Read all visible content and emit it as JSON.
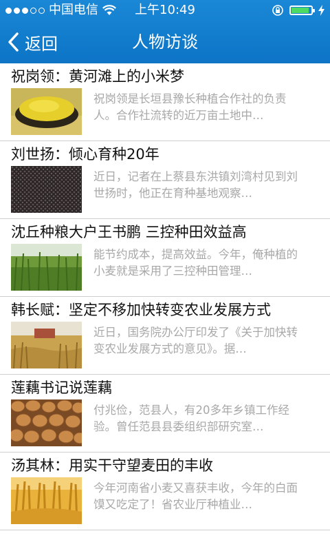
{
  "status_bar": {
    "carrier": "中国电信",
    "time": "上午10:49",
    "signal_bars_filled": 3,
    "signal_bars_total": 5,
    "battery_level": 0.9
  },
  "nav": {
    "back_label": "返回",
    "title": "人物访谈"
  },
  "colors": {
    "nav_background": "#1a88d6",
    "title_text": "#111111",
    "summary_text": "#a8a8a8",
    "divider": "#cfcfcf"
  },
  "articles": [
    {
      "title": "祝岗领：黄河滩上的小米梦",
      "summary": "祝岗领是长垣县豫长种植合作社的负责人。合作社流转的近万亩土地中…",
      "thumbnail": "millet-bowl-image"
    },
    {
      "title": "刘世扬：倾心育种20年",
      "summary": "近日，记者在上蔡县东洪镇刘湾村见到刘世扬时，他正在育种基地观察…",
      "thumbnail": "seeds-image"
    },
    {
      "title": "沈丘种粮大户王书鹏 三控种田效益高",
      "summary": "能节约成本，提高效益。今年，俺种植的小麦就是采用了三控种田管理…",
      "thumbnail": "green-wheat-field-image"
    },
    {
      "title": "韩长赋：坚定不移加快转变农业发展方式",
      "summary": "近日，国务院办公厅印发了《关于加快转变农业发展方式的意见》。据…",
      "thumbnail": "harvest-field-image"
    },
    {
      "title": "莲藕书记说莲藕",
      "summary": "付兆俭，范县人，有20多年乡镇工作经验。曾任范县县委组织部研究室…",
      "thumbnail": "potatoes-image"
    },
    {
      "title": "汤其林：用实干守望麦田的丰收",
      "summary": "今年河南省小麦又喜获丰收，今年的白面馍又吃定了！省农业厅种植业…",
      "thumbnail": "golden-wheat-image"
    }
  ]
}
